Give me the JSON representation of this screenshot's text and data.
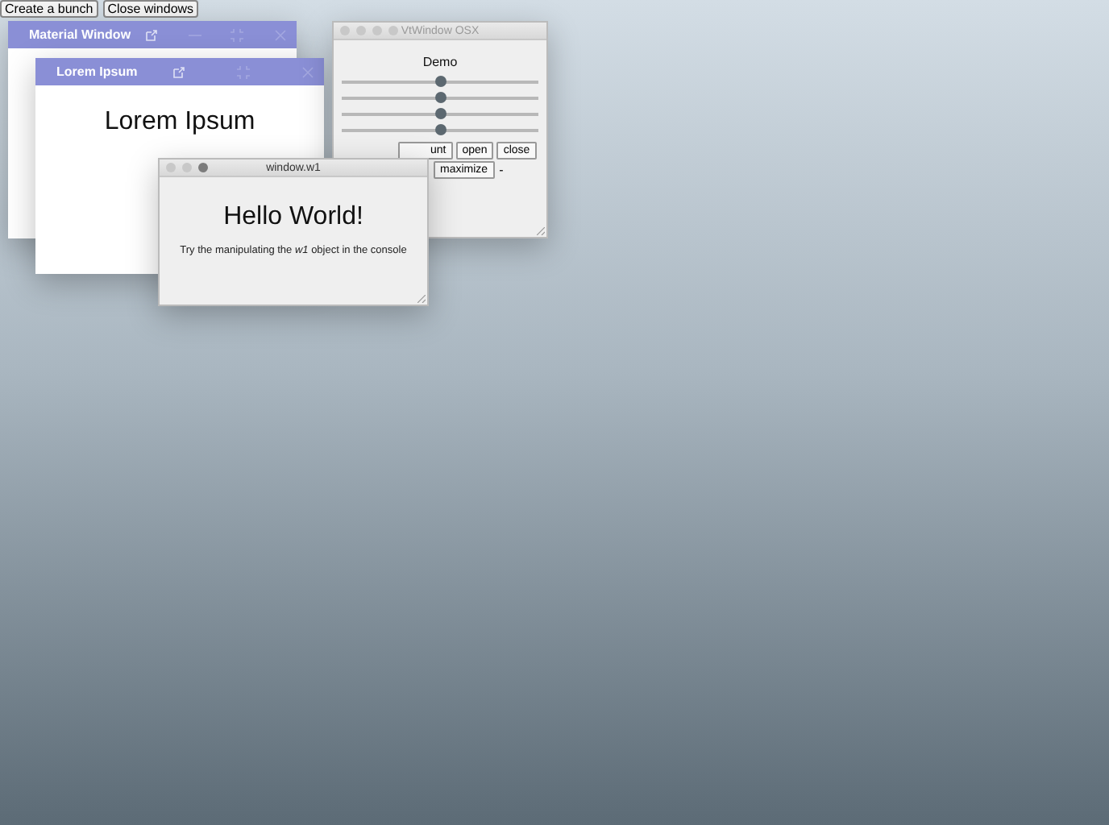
{
  "toolbar": {
    "buttons": [
      "Create a bunch",
      "Close windows"
    ]
  },
  "windows": [
    {
      "kind": "material",
      "title": "Material Window",
      "controls": [
        {
          "kind": "external"
        },
        {
          "kind": "minimize"
        },
        {
          "kind": "fullscreen"
        },
        {
          "kind": "close"
        }
      ]
    },
    {
      "kind": "material",
      "title": "Lorem Ipsum",
      "heading": "Lorem Ipsum",
      "controls": [
        {
          "kind": "external"
        },
        {
          "kind": "fullscreen"
        },
        {
          "kind": "close"
        }
      ]
    },
    {
      "kind": "osx",
      "title": "VtWindow OSX",
      "heading": "Demo",
      "sliders": [
        {
          "level": 0.5
        },
        {
          "level": 0.5
        },
        {
          "level": 0.5
        },
        {
          "level": 0.5
        }
      ],
      "button_rows": [
        [
          "unt",
          "open",
          "close"
        ],
        [
          "maximize"
        ]
      ],
      "trailing": "-"
    },
    {
      "kind": "osx-small",
      "title": "window.w1",
      "heading": "Hello World!",
      "text": "Try the manipulating the *w1* object in the console"
    }
  ]
}
